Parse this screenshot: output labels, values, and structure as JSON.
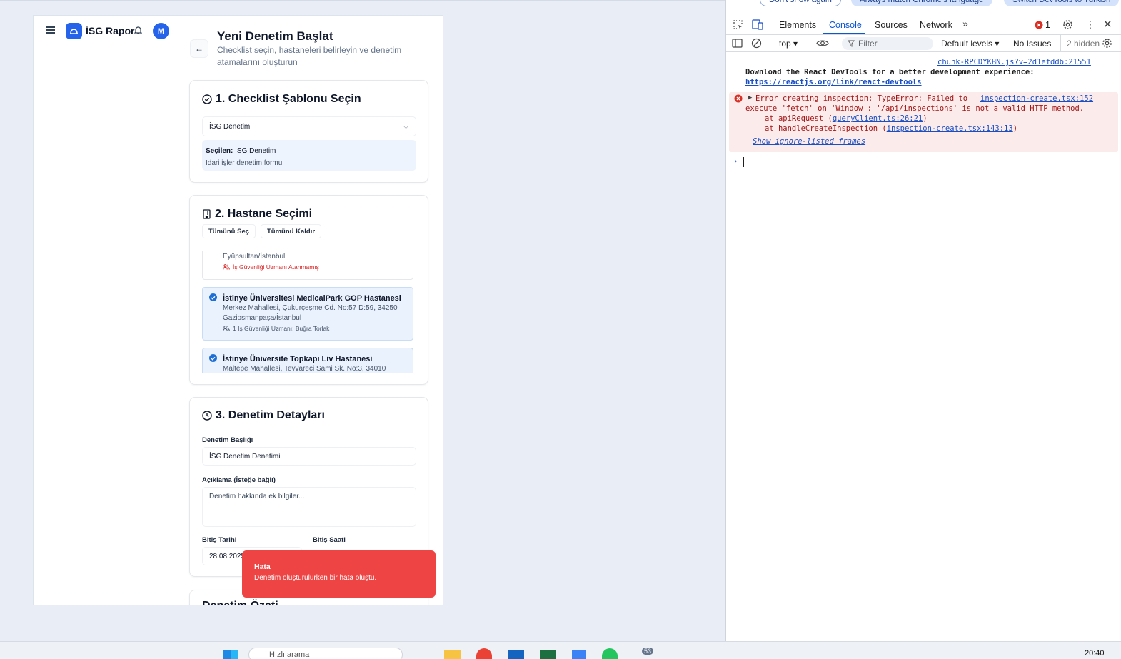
{
  "app": {
    "brand": "İSG Rapor",
    "avatar_initial": "M",
    "page_title": "Yeni Denetim Başlat",
    "page_subtitle": "Checklist seçin, hastaneleri belirleyin ve denetim atamalarını oluşturun"
  },
  "section1": {
    "title": "1. Checklist Şablonu Seçin",
    "select_value": "İSG Denetim",
    "selected_label": "Seçilen:",
    "selected_value": "İSG Denetim",
    "selected_desc": "İdari işler denetim formu"
  },
  "section2": {
    "title": "2. Hastane Seçimi",
    "select_all": "Tümünü Seç",
    "clear_all": "Tümünü Kaldır",
    "hospitals": [
      {
        "name": "",
        "address": "Eyüpsultan/İstanbul",
        "specialist": "İş Güvenliği Uzmanı Atanmamış",
        "selected": false
      },
      {
        "name": "İstinye Üniversitesi MedicalPark GOP Hastanesi",
        "address": "Merkez Mahallesi, Çukurçeşme Cd. No:57 D:59, 34250 Gaziosmanpaşa/İstanbul",
        "specialist": "1 İş Güvenliği Uzmanı: Buğra Torlak",
        "selected": true
      },
      {
        "name": "İstinye Üniversite Topkapı Liv Hastanesi",
        "address": "Maltepe Mahallesi, Tevvareci Sami Sk. No:3, 34010",
        "specialist": "",
        "selected": true
      }
    ]
  },
  "section3": {
    "title": "3. Denetim Detayları",
    "title_label": "Denetim Başlığı",
    "title_value": "İSG Denetim Denetimi",
    "desc_label": "Açıklama (İsteğe bağlı)",
    "desc_placeholder": "Denetim hakkında ek bilgiler...",
    "end_date_label": "Bitiş Tarihi",
    "end_date_value": "28.08.2025",
    "end_time_label": "Bitiş Saati"
  },
  "section4": {
    "title": "Denetim Özeti"
  },
  "toast": {
    "title": "Hata",
    "message": "Denetim oluşturulurken bir hata oluştu."
  },
  "devtools": {
    "infobar": [
      "Don't show again",
      "Always match Chrome's language",
      "Switch DevTools to Turkish"
    ],
    "tabs": [
      "Elements",
      "Console",
      "Sources",
      "Network"
    ],
    "active_tab": "Console",
    "error_count": "1",
    "context": "top",
    "filter_placeholder": "Filter",
    "levels": "Default levels",
    "issues": "No Issues",
    "hidden": "2 hidden",
    "messages": {
      "src1": "chunk-RPCDYKBN.js?v=2d1efddb:21551",
      "msg1": "Download the React DevTools for a better development experience:",
      "link1": "https://reactjs.org/link/react-devtools",
      "err_src": "inspection-create.tsx:152",
      "err_line1": "Error creating inspection: TypeError: Failed to",
      "err_line2": "execute 'fetch' on 'Window': '/api/inspections' is not a valid HTTP method.",
      "err_at1_pre": "at apiRequest (",
      "err_at1_link": "queryClient.ts:26:21",
      "err_at2_pre": "at handleCreateInspection (",
      "err_at2_link": "inspection-create.tsx:143:13",
      "show_frames": "Show ignore-listed frames"
    }
  },
  "taskbar": {
    "search_placeholder": "Hızlı arama",
    "clock": "20:40",
    "badge": "53"
  },
  "colors": {
    "primary": "#2563eb",
    "toast": "#ef4444",
    "devtools_accent": "#0b57d0",
    "error_bg": "#fcebeb"
  }
}
